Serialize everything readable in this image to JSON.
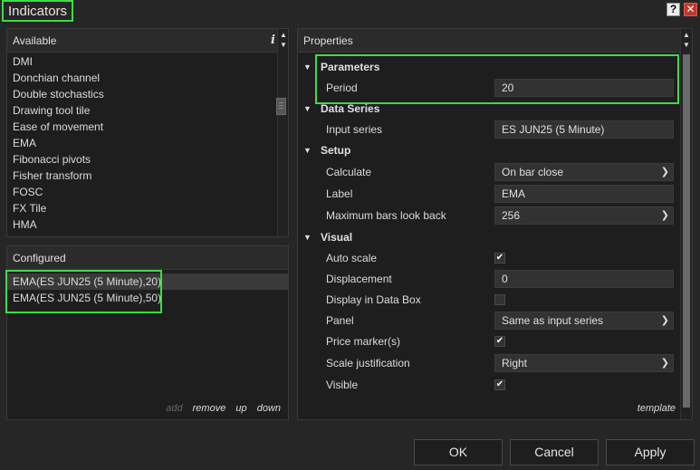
{
  "window": {
    "title": "Indicators",
    "help_label": "?",
    "close_label": "✕"
  },
  "available": {
    "header": "Available",
    "info_label": "i",
    "items": [
      "DMI",
      "Donchian channel",
      "Double stochastics",
      "Drawing tool tile",
      "Ease of movement",
      "EMA",
      "Fibonacci pivots",
      "Fisher transform",
      "FOSC",
      "FX Tile",
      "HMA"
    ]
  },
  "configured": {
    "header": "Configured",
    "items": [
      "EMA(ES JUN25 (5 Minute),20)",
      "EMA(ES JUN25 (5 Minute),50)"
    ],
    "actions": {
      "add": "add",
      "remove": "remove",
      "up": "up",
      "down": "down"
    }
  },
  "properties": {
    "header": "Properties",
    "categories": {
      "parameters": "Parameters",
      "data_series": "Data Series",
      "setup": "Setup",
      "visual": "Visual"
    },
    "period": {
      "label": "Period",
      "value": "20"
    },
    "input_series": {
      "label": "Input series",
      "value": "ES JUN25 (5 Minute)"
    },
    "calculate": {
      "label": "Calculate",
      "value": "On bar close"
    },
    "label_field": {
      "label": "Label",
      "value": "EMA"
    },
    "max_bars": {
      "label": "Maximum bars look back",
      "value": "256"
    },
    "auto_scale": {
      "label": "Auto scale",
      "checked": true
    },
    "displacement": {
      "label": "Displacement",
      "value": "0"
    },
    "display_in_data_box": {
      "label": "Display in Data Box",
      "checked": false
    },
    "panel": {
      "label": "Panel",
      "value": "Same as input series"
    },
    "price_markers": {
      "label": "Price marker(s)",
      "checked": true
    },
    "scale_justification": {
      "label": "Scale justification",
      "value": "Right"
    },
    "visible": {
      "label": "Visible",
      "checked": true
    },
    "template_label": "template"
  },
  "buttons": {
    "ok": "OK",
    "cancel": "Cancel",
    "apply": "Apply"
  },
  "colors": {
    "highlight": "#3ddc45",
    "background": "#262626",
    "panel": "#1e1e1e"
  }
}
